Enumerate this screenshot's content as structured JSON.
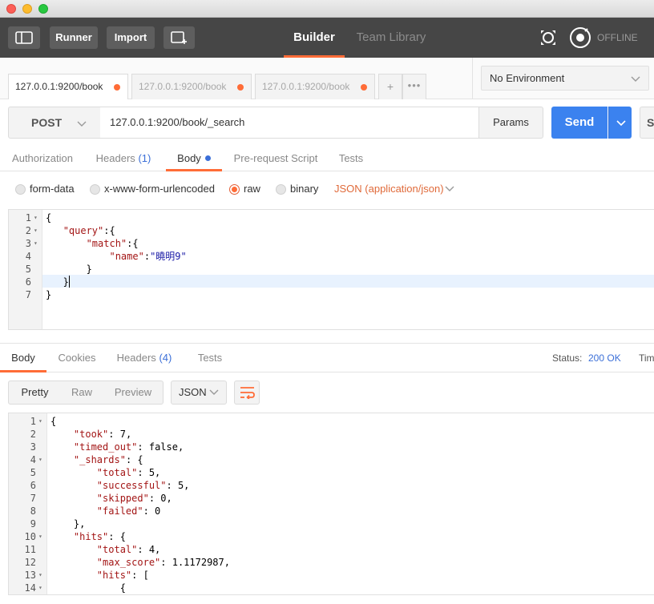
{
  "toolbar": {
    "runner_label": "Runner",
    "import_label": "Import",
    "builder_label": "Builder",
    "team_library_label": "Team Library",
    "offline_label": "OFFLINE",
    "icons": [
      "sidebar-toggle-icon",
      "new-window-icon",
      "sync-icon",
      "satellite-icon"
    ]
  },
  "tabs": [
    {
      "label": "127.0.0.1:9200/book",
      "active": true
    },
    {
      "label": "127.0.0.1:9200/book",
      "active": false
    },
    {
      "label": "127.0.0.1:9200/book",
      "active": false
    }
  ],
  "tab_add_label": "+",
  "tab_more_label": "•••",
  "environment": {
    "selected": "No Environment"
  },
  "request": {
    "method": "POST",
    "url": "127.0.0.1:9200/book/_search",
    "params_label": "Params",
    "send_label": "Send",
    "save_label": "S"
  },
  "request_subtabs": {
    "authorization": "Authorization",
    "headers": "Headers",
    "headers_count": "(1)",
    "body": "Body",
    "prerequest": "Pre-request Script",
    "tests": "Tests"
  },
  "body_modes": {
    "form_data": "form-data",
    "urlencoded": "x-www-form-urlencoded",
    "raw": "raw",
    "binary": "binary",
    "json_type": "JSON (application/json)",
    "selected": "raw"
  },
  "request_body_lines": [
    {
      "n": "1",
      "fold": true,
      "text": "{"
    },
    {
      "n": "2",
      "fold": true,
      "text": "   \"query\":{"
    },
    {
      "n": "3",
      "fold": true,
      "text": "       \"match\":{"
    },
    {
      "n": "4",
      "fold": false,
      "text": "           \"name\":\"曉明9\""
    },
    {
      "n": "5",
      "fold": false,
      "text": "       }"
    },
    {
      "n": "6",
      "fold": false,
      "text": "   }"
    },
    {
      "n": "7",
      "fold": false,
      "text": "}"
    }
  ],
  "response_subtabs": {
    "body": "Body",
    "cookies": "Cookies",
    "headers": "Headers",
    "headers_count": "(4)",
    "tests": "Tests",
    "status_label": "Status:",
    "status_value": "200 OK",
    "time_label": "Time"
  },
  "response_toolbar": {
    "pretty": "Pretty",
    "raw": "Raw",
    "preview": "Preview",
    "format": "JSON"
  },
  "response_body_lines": [
    {
      "n": "1",
      "fold": true,
      "text": "{"
    },
    {
      "n": "2",
      "fold": false,
      "text": "    \"took\": 7,"
    },
    {
      "n": "3",
      "fold": false,
      "text": "    \"timed_out\": false,"
    },
    {
      "n": "4",
      "fold": true,
      "text": "    \"_shards\": {"
    },
    {
      "n": "5",
      "fold": false,
      "text": "        \"total\": 5,"
    },
    {
      "n": "6",
      "fold": false,
      "text": "        \"successful\": 5,"
    },
    {
      "n": "7",
      "fold": false,
      "text": "        \"skipped\": 0,"
    },
    {
      "n": "8",
      "fold": false,
      "text": "        \"failed\": 0"
    },
    {
      "n": "9",
      "fold": false,
      "text": "    },"
    },
    {
      "n": "10",
      "fold": true,
      "text": "    \"hits\": {"
    },
    {
      "n": "11",
      "fold": false,
      "text": "        \"total\": 4,"
    },
    {
      "n": "12",
      "fold": false,
      "text": "        \"max_score\": 1.1172987,"
    },
    {
      "n": "13",
      "fold": true,
      "text": "        \"hits\": ["
    },
    {
      "n": "14",
      "fold": true,
      "text": "            {"
    }
  ],
  "colors": {
    "accent": "#ff6c37",
    "send": "#3b82ef",
    "toolbar": "#464646",
    "link": "#3b6fd8"
  }
}
